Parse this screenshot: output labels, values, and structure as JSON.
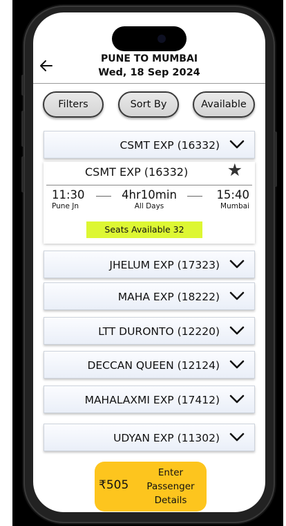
{
  "header": {
    "route": "PUNE TO MUMBAI",
    "date": "Wed, 18 Sep 2024"
  },
  "toolbar": {
    "filters_label": "Filters",
    "sort_label": "Sort By",
    "available_label": "Available"
  },
  "trains": [
    {
      "name": "CSMT EXP (16332)"
    },
    {
      "name": "JHELUM EXP (17323)"
    },
    {
      "name": "MAHA EXP (18222)"
    },
    {
      "name": "LTT DURONTO (12220)"
    },
    {
      "name": "DECCAN QUEEN (12124)"
    },
    {
      "name": "MAHALAXMI EXP (17412)"
    },
    {
      "name": "UDYAN EXP (11302)"
    }
  ],
  "expanded": {
    "name": "CSMT EXP (16332)",
    "depart_time": "11:30",
    "duration": "4hr10min",
    "arrive_time": "15:40",
    "from": "Pune Jn",
    "frequency": "All Days",
    "to": "Mumbai",
    "seats": "Seats Available 32"
  },
  "booking": {
    "price": "₹505",
    "line1": "Enter",
    "line2": "Passenger",
    "line3": "Details"
  },
  "icons": {
    "back": "back-arrow-icon",
    "chevron": "chevron-down-icon",
    "favorite": "star-icon"
  },
  "colors": {
    "seats_highlight": "#ddf733",
    "book_button": "#fdc51e"
  }
}
